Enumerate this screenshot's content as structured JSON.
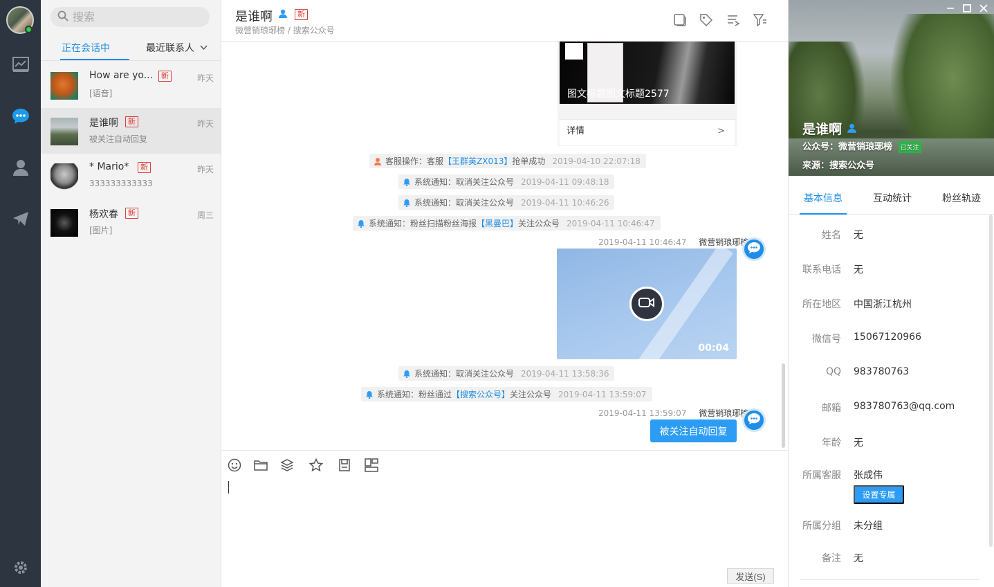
{
  "sidebar": {
    "nav_icons": [
      "chart-icon",
      "chat-bubble-icon",
      "contacts-icon",
      "send-icon",
      "settings-icon"
    ],
    "active_color": "#1e8ee8"
  },
  "conversations": {
    "search_placeholder": "搜索",
    "tabs": [
      "正在会话中",
      "最近联系人"
    ],
    "new_badge": "新",
    "items": [
      {
        "name": "How are yo...",
        "preview": "[语音]",
        "time": "昨天"
      },
      {
        "name": "是谁啊",
        "preview": "被关注自动回复",
        "time": "昨天"
      },
      {
        "name": " * Mario*",
        "preview": "333333333333",
        "time": "昨天"
      },
      {
        "name": "杨欢春",
        "preview": "[图片]",
        "time": "周三"
      }
    ]
  },
  "chat": {
    "title": "是谁啊",
    "new_badge": "新",
    "subtitle": "微营销琅琊榜 / 搜索公众号",
    "card": {
      "title": "图文标题图文标题2577",
      "detail": "详情",
      "arrow": ">"
    },
    "system_messages": [
      {
        "prefix": "客服操作：客服",
        "highlight": "【王群英ZX013】",
        "suffix": "抢单成功",
        "time": "2019-04-10 22:07:18"
      },
      {
        "prefix": "系统通知：取消关注公众号",
        "highlight": "",
        "suffix": "",
        "time": "2019-04-11 09:48:18"
      },
      {
        "prefix": "系统通知：取消关注公众号",
        "highlight": "",
        "suffix": "",
        "time": "2019-04-11 10:46:26"
      },
      {
        "prefix": "系统通知：粉丝扫描粉丝海报",
        "highlight": "【黑曼巴】",
        "suffix": "关注公众号",
        "time": "2019-04-11 10:46:47"
      },
      {
        "prefix": "系统通知：取消关注公众号",
        "highlight": "",
        "suffix": "",
        "time": "2019-04-11 13:58:36"
      },
      {
        "prefix": "系统通知：粉丝通过",
        "highlight": "【搜索公众号】",
        "suffix": "关注公众号",
        "time": "2019-04-11 13:59:07"
      }
    ],
    "video_message": {
      "time": "2019-04-11 10:46:47",
      "account": "微营销琅琊榜",
      "duration": "00:04"
    },
    "text_message": {
      "time": "2019-04-11 13:59:07",
      "account": "微营销琅琊榜",
      "text": "被关注自动回复"
    },
    "send_label": "发送(S)"
  },
  "profile": {
    "name": "是谁啊",
    "account_line": "公众号：微营销琅琊榜",
    "followed_badge": "已关注",
    "source_line": "来源：搜索公众号",
    "tabs": [
      "基本信息",
      "互动统计",
      "粉丝轨迹"
    ],
    "fields": [
      {
        "label": "姓名",
        "value": "无"
      },
      {
        "label": "联系电话",
        "value": "无"
      },
      {
        "label": "所在地区",
        "value": "中国浙江杭州"
      },
      {
        "label": "微信号",
        "value": "15067120966"
      },
      {
        "label": "QQ",
        "value": "983780763"
      },
      {
        "label": "邮箱",
        "value": "983780763@qq.com"
      },
      {
        "label": "年龄",
        "value": "无"
      },
      {
        "label": "所属客服",
        "value": "张成伟"
      },
      {
        "label": "所属分组",
        "value": "未分组"
      },
      {
        "label": "备注",
        "value": "无"
      }
    ],
    "assign_button": "设置专属"
  }
}
